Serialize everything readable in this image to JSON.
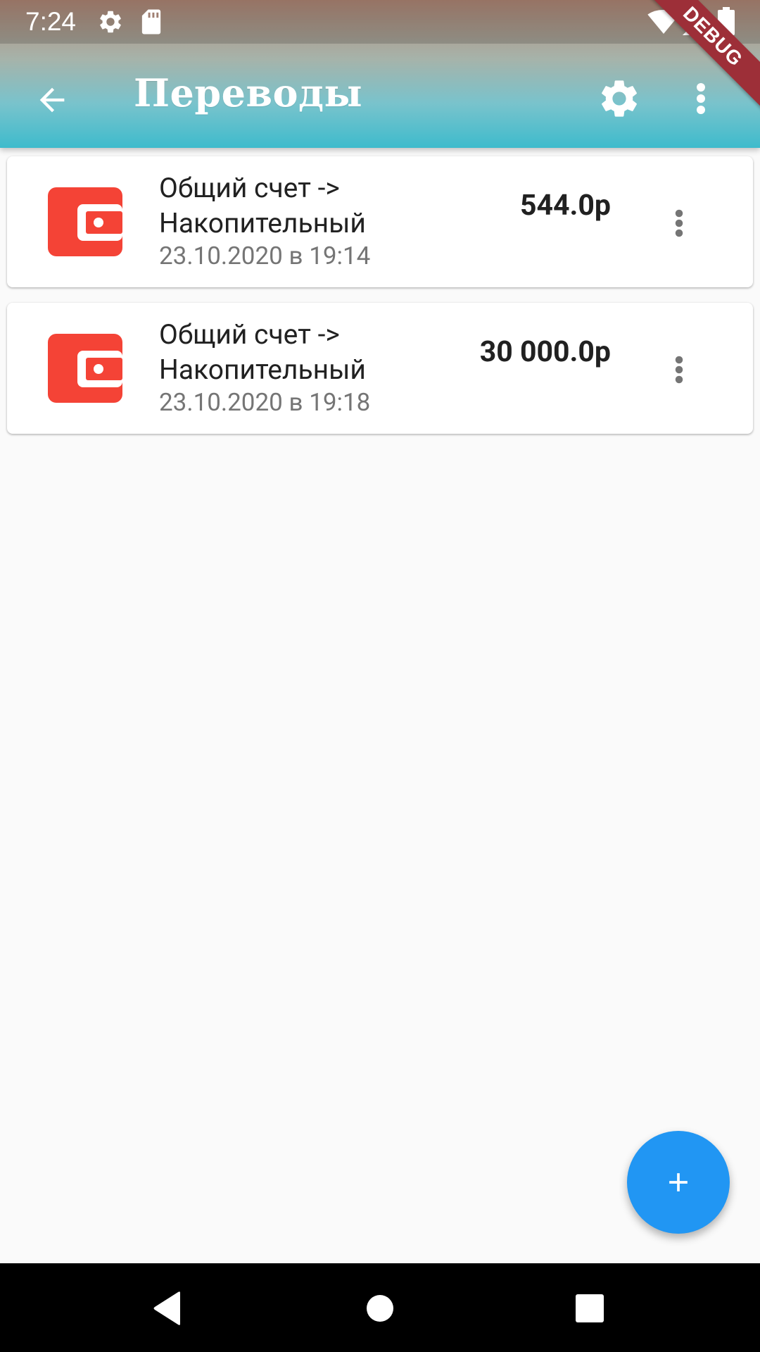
{
  "status_bar": {
    "time": "7:24",
    "icons": [
      "gear-icon",
      "sd-card-icon",
      "wifi-icon",
      "signal-icon",
      "battery-icon"
    ]
  },
  "app_bar": {
    "title": "Переводы",
    "back_icon": "arrow-left-icon",
    "settings_icon": "gear-icon",
    "more_icon": "more-vertical-icon"
  },
  "debug_ribbon": "DEBUG",
  "transfers": [
    {
      "title": "Общий счет -> Накопительный",
      "date": "23.10.2020 в 19:14",
      "amount": "544.0р",
      "icon": "wallet-icon"
    },
    {
      "title": "Общий счет -> Накопительный",
      "date": "23.10.2020 в 19:18",
      "amount": "30 000.0р",
      "icon": "wallet-icon"
    }
  ],
  "fab": {
    "icon": "plus-icon"
  },
  "navigation": {
    "icons": [
      "back-triangle-icon",
      "home-circle-icon",
      "recents-square-icon"
    ]
  },
  "colors": {
    "wallet_red": "#f44336",
    "fab_blue": "#2196f3",
    "appbar_teal": "#3ebbcc"
  }
}
